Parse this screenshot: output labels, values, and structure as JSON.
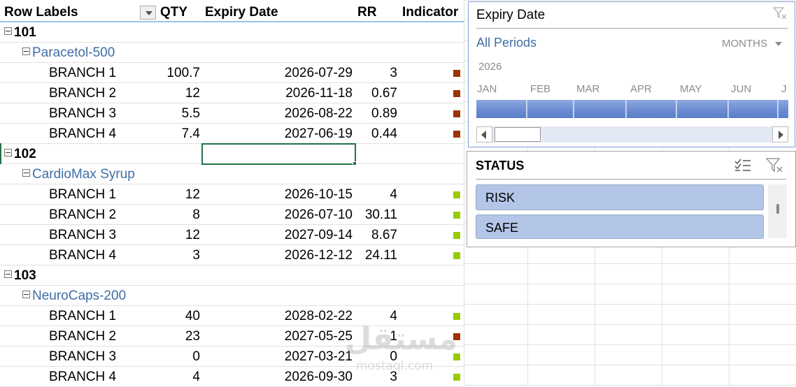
{
  "pivot": {
    "headers": {
      "row_labels": "Row Labels",
      "qty": "QTY",
      "expiry": "Expiry Date",
      "rr": "RR",
      "indicator": "Indicator"
    },
    "groups": [
      {
        "id": "101",
        "product": "Paracetol-500",
        "rows": [
          {
            "branch": "BRANCH 1",
            "qty": "100.7",
            "expiry": "2026-07-29",
            "rr": "3",
            "status": "risk"
          },
          {
            "branch": "BRANCH 2",
            "qty": "12",
            "expiry": "2026-11-18",
            "rr": "0.67",
            "status": "risk"
          },
          {
            "branch": "BRANCH 3",
            "qty": "5.5",
            "expiry": "2026-08-22",
            "rr": "0.89",
            "status": "risk"
          },
          {
            "branch": "BRANCH 4",
            "qty": "7.4",
            "expiry": "2027-06-19",
            "rr": "0.44",
            "status": "risk"
          }
        ]
      },
      {
        "id": "102",
        "product": "CardioMax Syrup",
        "rows": [
          {
            "branch": "BRANCH 1",
            "qty": "12",
            "expiry": "2026-10-15",
            "rr": "4",
            "status": "safe"
          },
          {
            "branch": "BRANCH 2",
            "qty": "8",
            "expiry": "2026-07-10",
            "rr": "30.11",
            "status": "safe"
          },
          {
            "branch": "BRANCH 3",
            "qty": "12",
            "expiry": "2027-09-14",
            "rr": "8.67",
            "status": "safe"
          },
          {
            "branch": "BRANCH 4",
            "qty": "3",
            "expiry": "2026-12-12",
            "rr": "24.11",
            "status": "safe"
          }
        ]
      },
      {
        "id": "103",
        "product": "NeuroCaps-200",
        "rows": [
          {
            "branch": "BRANCH 1",
            "qty": "40",
            "expiry": "2028-02-22",
            "rr": "4",
            "status": "safe"
          },
          {
            "branch": "BRANCH 2",
            "qty": "23",
            "expiry": "2027-05-25",
            "rr": "1",
            "status": "risk"
          },
          {
            "branch": "BRANCH 3",
            "qty": "0",
            "expiry": "2027-03-21",
            "rr": "0",
            "status": "safe"
          },
          {
            "branch": "BRANCH 4",
            "qty": "4",
            "expiry": "2026-09-30",
            "rr": "3",
            "status": "safe"
          }
        ]
      }
    ]
  },
  "colors": {
    "risk": "#9c3300",
    "safe": "#99cc00",
    "product_text": "#3e6ea6",
    "accent_green": "#217346"
  },
  "timeline": {
    "title": "Expiry Date",
    "all_periods": "All Periods",
    "level": "MONTHS",
    "year": "2026",
    "months": [
      "JAN",
      "FEB",
      "MAR",
      "APR",
      "MAY",
      "JUN",
      "J"
    ]
  },
  "status_slicer": {
    "title": "STATUS",
    "items": [
      "RISK",
      "SAFE"
    ]
  },
  "watermark": {
    "arabic": "مستقل",
    "latin": "mostaql.com"
  }
}
